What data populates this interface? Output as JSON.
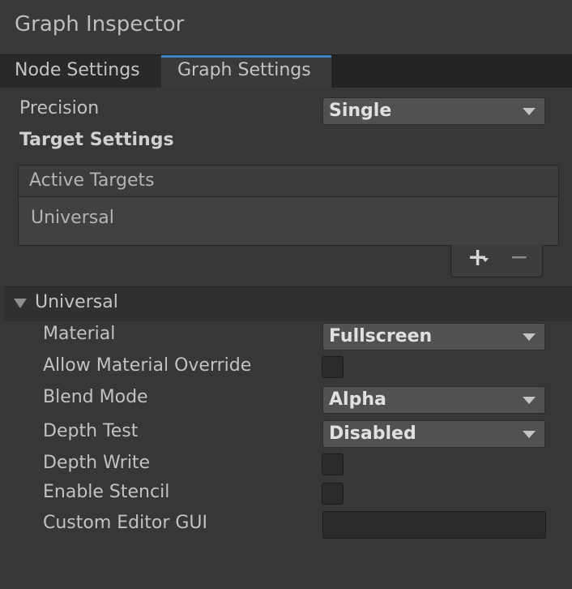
{
  "window": {
    "title": "Graph Inspector"
  },
  "tabs": [
    {
      "label": "Node Settings",
      "active": false
    },
    {
      "label": "Graph Settings",
      "active": true
    }
  ],
  "graph_settings": {
    "precision": {
      "label": "Precision",
      "value": "Single"
    },
    "target_settings_heading": "Target Settings",
    "active_targets": {
      "header": "Active Targets",
      "items": [
        "Universal"
      ],
      "add_icon": "plus-icon",
      "remove_icon": "minus-icon"
    }
  },
  "universal_section": {
    "label": "Universal",
    "expanded": true,
    "material": {
      "label": "Material",
      "value": "Fullscreen"
    },
    "allow_material_override": {
      "label": "Allow Material Override",
      "checked": false
    },
    "blend_mode": {
      "label": "Blend Mode",
      "value": "Alpha"
    },
    "depth_test": {
      "label": "Depth Test",
      "value": "Disabled"
    },
    "depth_write": {
      "label": "Depth Write",
      "checked": false
    },
    "enable_stencil": {
      "label": "Enable Stencil",
      "checked": false
    },
    "custom_editor_gui": {
      "label": "Custom Editor GUI",
      "value": ""
    }
  },
  "colors": {
    "accent": "#3d85c6",
    "panel_bg": "#373737",
    "dropdown_bg": "#515151"
  }
}
